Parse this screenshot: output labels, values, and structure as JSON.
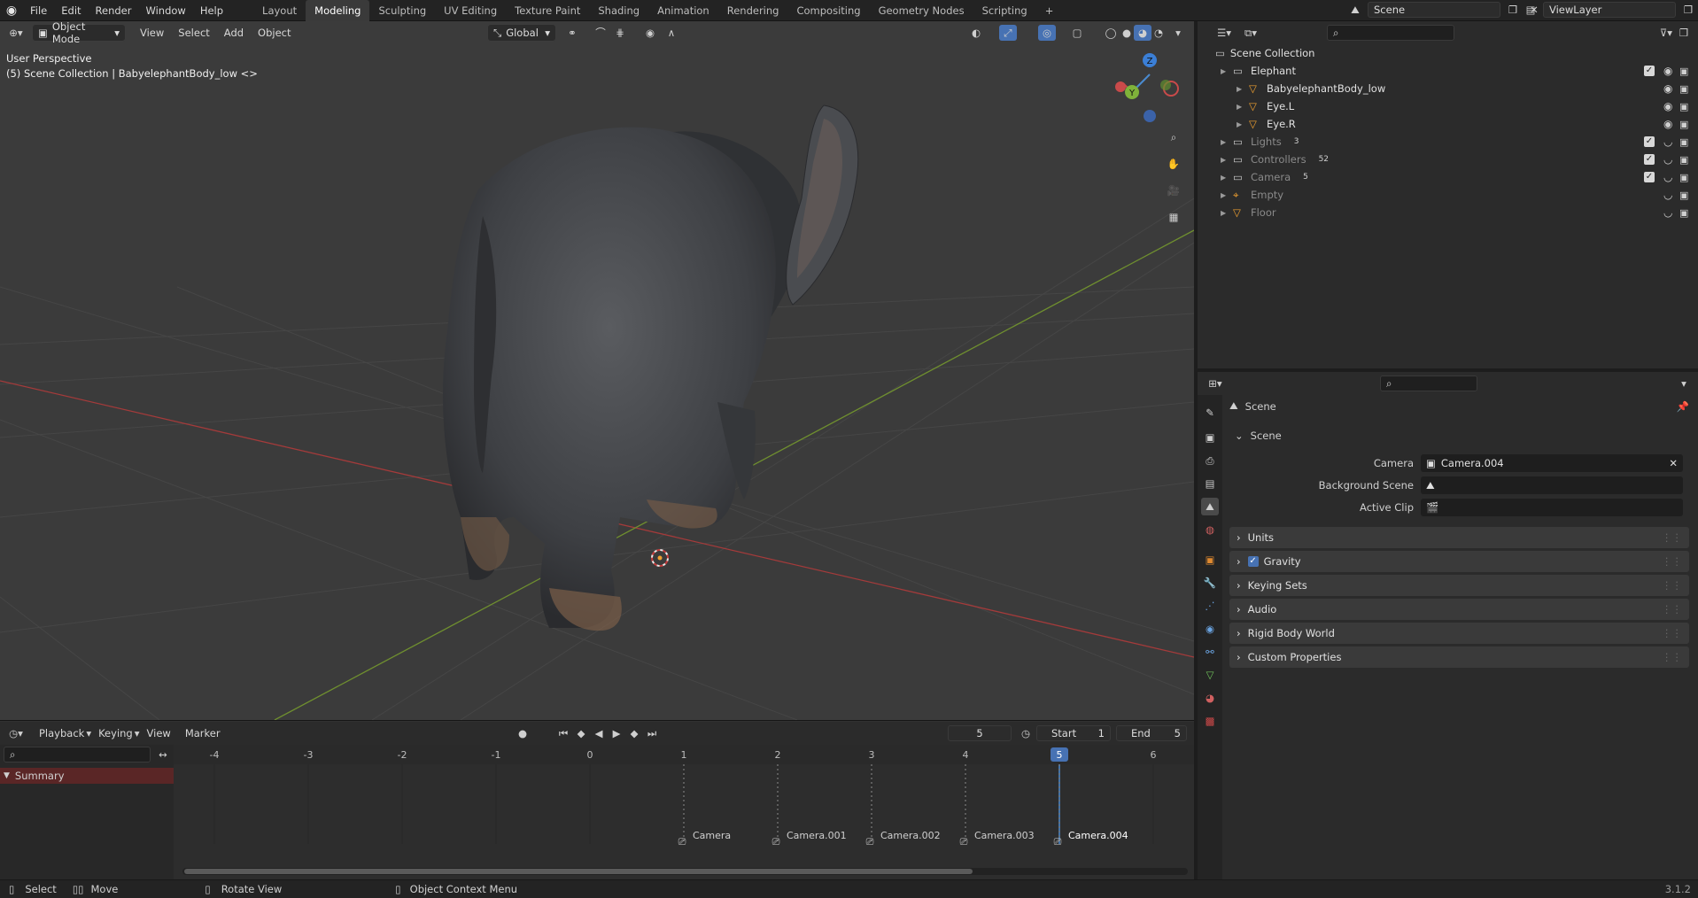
{
  "app": {
    "version": "3.1.2"
  },
  "menu": [
    "File",
    "Edit",
    "Render",
    "Window",
    "Help"
  ],
  "workspaces": [
    "Layout",
    "Modeling",
    "Sculpting",
    "UV Editing",
    "Texture Paint",
    "Shading",
    "Animation",
    "Rendering",
    "Compositing",
    "Geometry Nodes",
    "Scripting"
  ],
  "active_workspace": "Modeling",
  "scene_selector": {
    "value": "Scene"
  },
  "viewlayer_selector": {
    "value": "ViewLayer"
  },
  "viewport": {
    "mode": "Object Mode",
    "menus": [
      "View",
      "Select",
      "Add",
      "Object"
    ],
    "orientation": "Global",
    "info_line1": "User Perspective",
    "info_line2": "(5) Scene Collection | BabyelephantBody_low <>",
    "gizmo": {
      "z": "Z",
      "y": "Y"
    }
  },
  "outliner": {
    "root": "Scene Collection",
    "rows": [
      {
        "label": "Elephant",
        "indent": 1,
        "icon": "collection-icon",
        "checked": true,
        "dim": false
      },
      {
        "label": "BabyelephantBody_low",
        "indent": 2,
        "icon": "mesh-object-icon",
        "checked": null,
        "dim": false
      },
      {
        "label": "Eye.L",
        "indent": 2,
        "icon": "mesh-object-icon",
        "checked": null,
        "dim": false
      },
      {
        "label": "Eye.R",
        "indent": 2,
        "icon": "mesh-object-icon",
        "checked": null,
        "dim": false
      },
      {
        "label": "Lights",
        "indent": 1,
        "icon": "collection-icon",
        "checked": true,
        "dim": true,
        "badge": "3"
      },
      {
        "label": "Controllers",
        "indent": 1,
        "icon": "collection-icon",
        "checked": true,
        "dim": true,
        "badge": "52"
      },
      {
        "label": "Camera",
        "indent": 1,
        "icon": "collection-icon",
        "checked": true,
        "dim": true,
        "badge": "5"
      },
      {
        "label": "Empty",
        "indent": 1,
        "icon": "empty-object-icon",
        "checked": null,
        "dim": true
      },
      {
        "label": "Floor",
        "indent": 1,
        "icon": "mesh-object-icon",
        "checked": null,
        "dim": true
      }
    ]
  },
  "properties": {
    "context_title": "Scene",
    "section_title": "Scene",
    "fields": [
      {
        "label": "Camera",
        "value": "Camera.004"
      },
      {
        "label": "Background Scene",
        "value": ""
      },
      {
        "label": "Active Clip",
        "value": ""
      }
    ],
    "panels": [
      "Units",
      "Gravity",
      "Keying Sets",
      "Audio",
      "Rigid Body World",
      "Custom Properties"
    ],
    "gravity_checked": true
  },
  "timeline": {
    "menus": [
      "Playback",
      "Keying",
      "View",
      "Marker"
    ],
    "current_frame": "5",
    "start_label": "Start",
    "start": "1",
    "end_label": "End",
    "end": "5",
    "ruler": [
      "-4",
      "-3",
      "-2",
      "-1",
      "0",
      "1",
      "2",
      "3",
      "4",
      "5",
      "6"
    ],
    "summary": "Summary",
    "markers": [
      "Camera",
      "Camera.001",
      "Camera.002",
      "Camera.003",
      "Camera.004"
    ]
  },
  "status": {
    "select": "Select",
    "move": "Move",
    "rotate": "Rotate View",
    "context": "Object Context Menu"
  }
}
